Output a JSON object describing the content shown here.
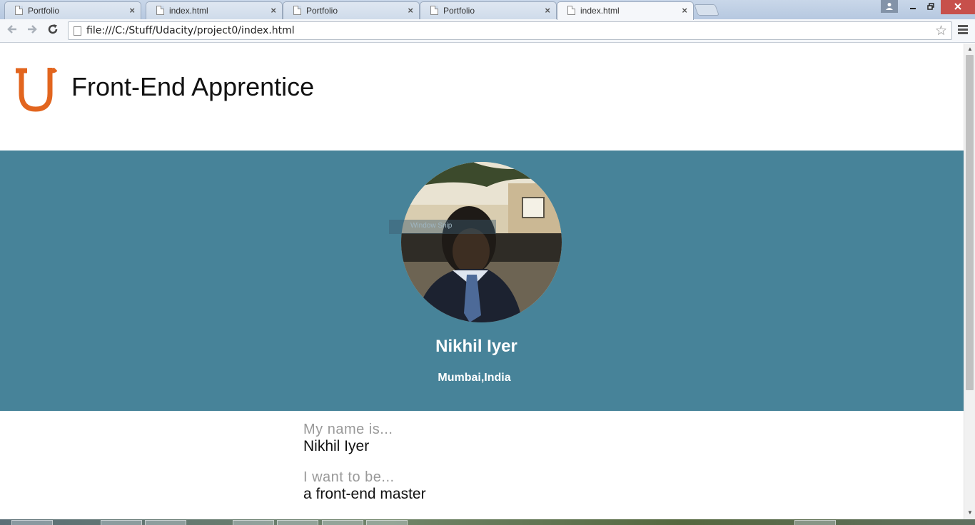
{
  "browser": {
    "tabs": [
      {
        "title": "Portfolio",
        "active": false
      },
      {
        "title": "index.html",
        "active": false
      },
      {
        "title": "Portfolio",
        "active": false
      },
      {
        "title": "Portfolio",
        "active": false
      },
      {
        "title": "index.html",
        "active": true
      }
    ],
    "tab_close_glyph": "×",
    "url": "file:///C:/Stuff/Udacity/project0/index.html"
  },
  "page": {
    "header_title": "Front-End Apprentice",
    "logo_color": "#e2651e",
    "hero_color": "#478399",
    "name": "Nikhil Iyer",
    "location": "Mumbai,India",
    "about": [
      {
        "question": "My name is...",
        "answer": "Nikhil Iyer"
      },
      {
        "question": "I want to be...",
        "answer": "a front-end master"
      }
    ]
  },
  "overlay": {
    "snip_label": "Window Snip"
  }
}
